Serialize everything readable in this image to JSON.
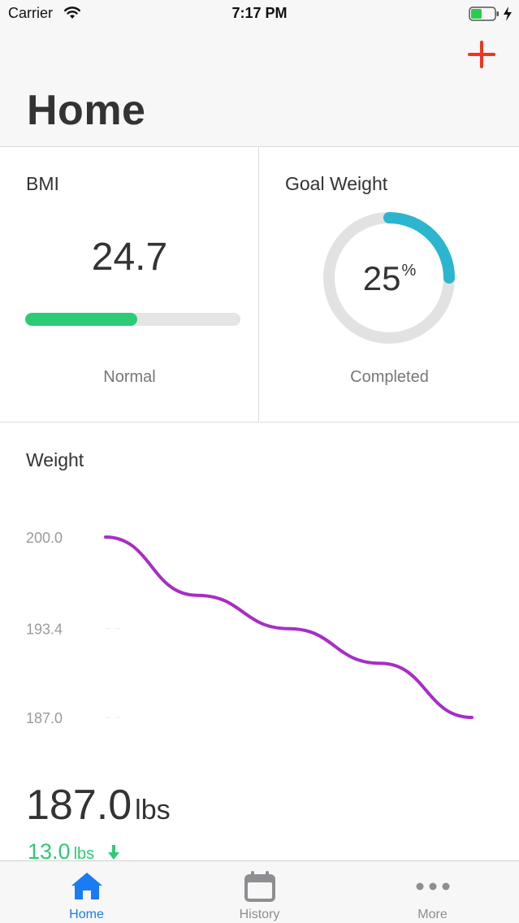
{
  "status_bar": {
    "carrier": "Carrier",
    "time": "7:17 PM"
  },
  "header": {
    "title": "Home",
    "add_icon": "plus-icon",
    "accent_color": "#f0351f"
  },
  "bmi_card": {
    "title": "BMI",
    "value": "24.7",
    "status": "Normal",
    "progress_fraction": 0.52,
    "bar_color": "#2ccb76"
  },
  "goal_card": {
    "title": "Goal Weight",
    "percent": "25",
    "percent_symbol": "%",
    "percent_value": 25,
    "caption": "Completed",
    "ring_color": "#2bb5cf"
  },
  "weight_card": {
    "title": "Weight",
    "current_value": "187.0",
    "current_unit": "lbs",
    "change_value": "13.0",
    "change_unit": "lbs",
    "change_direction": "down",
    "change_color": "#2ccb76"
  },
  "chart_data": {
    "type": "line",
    "y_ticks": [
      "200.0",
      "193.4",
      "187.0"
    ],
    "ylim": [
      187.0,
      200.0
    ],
    "series": [
      {
        "values": [
          200.0,
          195.8,
          193.4,
          190.9,
          187.0
        ]
      }
    ],
    "line_color": "#a72ec4",
    "grid": false
  },
  "tab_bar": {
    "tabs": [
      {
        "label": "Home",
        "icon": "home-icon",
        "active": true
      },
      {
        "label": "History",
        "icon": "calendar-icon",
        "active": false
      },
      {
        "label": "More",
        "icon": "more-icon",
        "active": false
      }
    ],
    "active_color": "#1a7cf5",
    "inactive_color": "#8e8e93"
  }
}
